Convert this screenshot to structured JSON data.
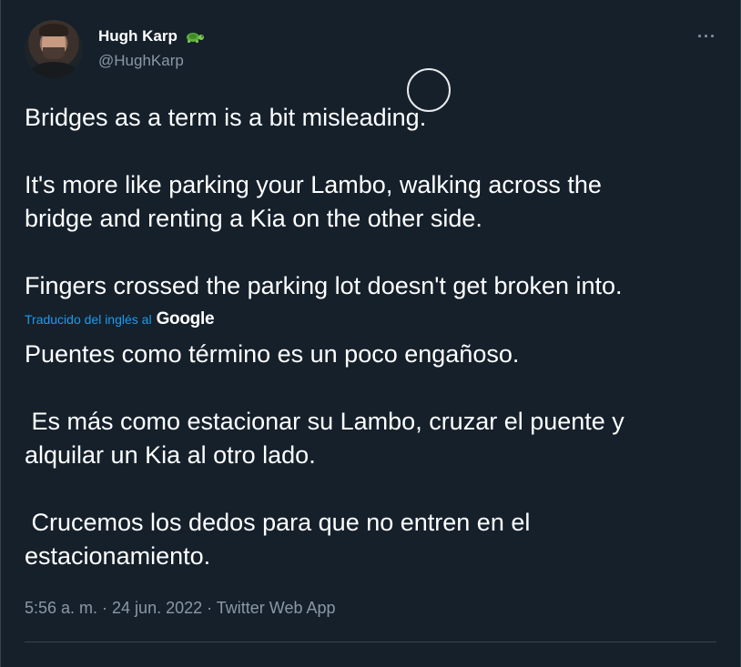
{
  "author": {
    "display_name": "Hugh Karp",
    "handle": "@HughKarp",
    "badge": "turtle-emoji"
  },
  "original_text": [
    "Bridges as a term is a bit misleading.",
    "",
    "It's more like parking your Lambo, walking across the",
    "bridge and renting a Kia on the other side.",
    "",
    "Fingers crossed the parking lot doesn't get broken into."
  ],
  "translation": {
    "label": "Traducido del inglés al",
    "provider": "Google",
    "lines": [
      "Puentes como término es un poco engañoso.",
      "",
      " Es más como estacionar su Lambo, cruzar el puente y",
      "alquilar un Kia al otro lado.",
      "",
      " Crucemos los dedos para que no entren en el",
      "estacionamiento."
    ]
  },
  "meta": {
    "text": "5:56 a. m. · 24 jun. 2022 · Twitter Web App"
  },
  "more_label": "···",
  "colors": {
    "background": "#15202b",
    "text": "#ffffff",
    "secondary": "#8b98a5",
    "link": "#1d9bf0",
    "divider": "#38444d"
  }
}
